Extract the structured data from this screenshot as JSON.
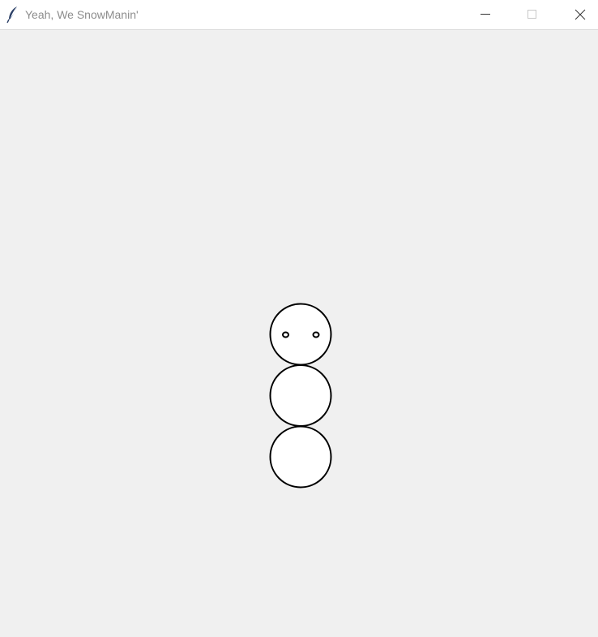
{
  "window": {
    "title": "Yeah, We SnowManin'",
    "icon": "feather-icon",
    "controls": [
      "minimize-icon",
      "maximize-icon",
      "close-icon"
    ]
  },
  "canvas": {
    "background": "#f0f0f0",
    "snowman": {
      "fill": "#ffffff",
      "outline": "#000000",
      "parts": [
        "head",
        "body",
        "base"
      ],
      "eyes": 2
    }
  }
}
